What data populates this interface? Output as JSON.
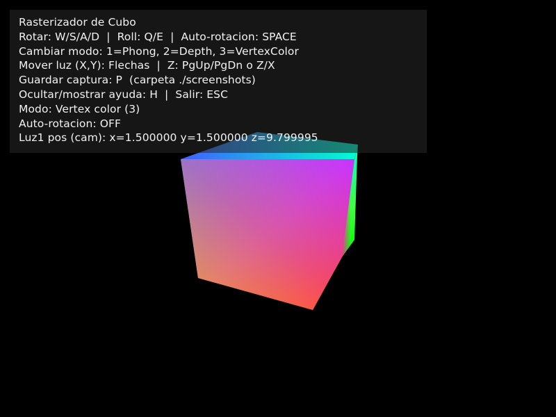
{
  "window": {
    "background": "#000000"
  },
  "hud": {
    "lines": [
      "Rasterizador de Cubo",
      "Rotar: W/S/A/D  |  Roll: Q/E  |  Auto-rotacion: SPACE",
      "Cambiar modo: 1=Phong, 2=Depth, 3=VertexColor",
      "Mover luz (X,Y): Flechas  |  Z: PgUp/PgDn o Z/X",
      "Guardar captura: P  (carpeta ./screenshots)",
      "Ocultar/mostrar ayuda: H  |  Salir: ESC",
      "Modo: Vertex color (3)",
      "Auto-rotacion: OFF",
      "Luz1 pos (cam): x=1.500000 y=1.500000 z=9.799995"
    ],
    "panel_color": "#282828",
    "text_color": "#f2f2f2"
  },
  "cube": {
    "render_mode": "vertex-color",
    "vertex_colors": {
      "front_top_left": "#00d0ff",
      "front_top_right": "#ff00ff",
      "front_bottom_left": "#ffe000",
      "front_bottom_right": "#ff0020",
      "back_top_right": "#00ffd0",
      "back_bottom_right": "#00ff00",
      "back_top_left": "#4060ff"
    }
  }
}
